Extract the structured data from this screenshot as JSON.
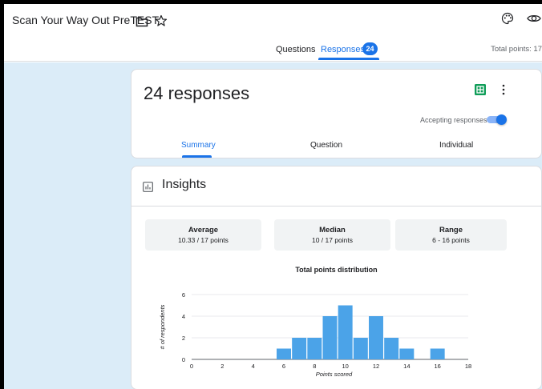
{
  "header": {
    "title": "Scan Your Way Out PreTEST",
    "tabs": [
      {
        "label": "Questions"
      },
      {
        "label": "Responses",
        "badge": "24"
      }
    ],
    "total_points": "Total points: 17"
  },
  "summary_card": {
    "responses_title": "24 responses",
    "accepting_label": "Accepting responses",
    "accepting": true,
    "subtabs": [
      "Summary",
      "Question",
      "Individual"
    ]
  },
  "insights": {
    "title": "Insights",
    "stats": [
      {
        "label": "Average",
        "value": "10.33 / 17 points"
      },
      {
        "label": "Median",
        "value": "10 / 17 points"
      },
      {
        "label": "Range",
        "value": "6 - 16 points"
      }
    ]
  },
  "colors": {
    "accent": "#1a73e8",
    "background": "#dbecf8",
    "bar": "#4ba3e8",
    "sheets": "#0f9d58"
  },
  "chart_data": {
    "type": "bar",
    "title": "Total points distribution",
    "xlabel": "Points scored",
    "ylabel": "# of respondents",
    "x": [
      6,
      7,
      8,
      9,
      10,
      11,
      12,
      13,
      14,
      15,
      16
    ],
    "values": [
      1,
      2,
      2,
      4,
      5,
      2,
      4,
      2,
      1,
      0,
      1
    ],
    "xlim": [
      0,
      18
    ],
    "ylim": [
      0,
      6
    ],
    "xticks": [
      0,
      2,
      4,
      6,
      8,
      10,
      12,
      14,
      16,
      18
    ],
    "yticks": [
      0,
      2,
      4,
      6
    ],
    "grid": true
  }
}
